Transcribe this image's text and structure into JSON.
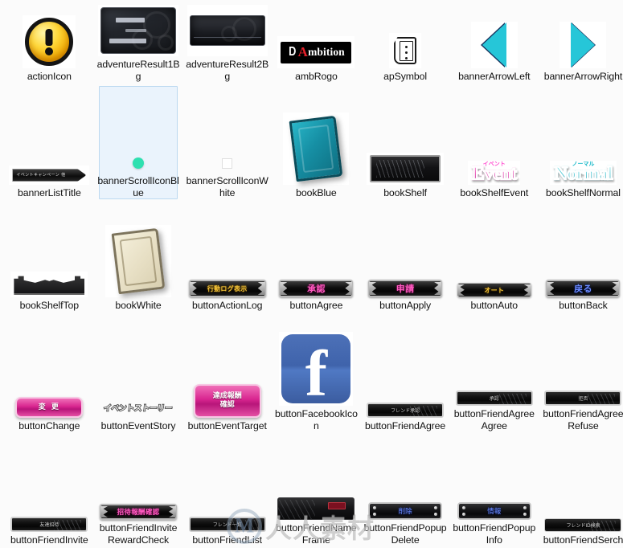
{
  "window": {
    "background_color": "#fbfbfb",
    "view": "icon-grid",
    "columns": 7,
    "rows": 5
  },
  "watermark": {
    "logo_letter": "M",
    "text": "人人素材"
  },
  "items": [
    {
      "id": "actionIcon",
      "label": "actionIcon",
      "icon": "warning-exclamation-icon",
      "selected": false
    },
    {
      "id": "adventureResult1Bg",
      "label": "adventureResult1Bg",
      "icon": "dark-card-background",
      "selected": false
    },
    {
      "id": "adventureResult2Bg",
      "label": "adventureResult2Bg",
      "icon": "dark-bar-background",
      "selected": false
    },
    {
      "id": "ambRogo",
      "label": "ambRogo",
      "icon": "ambition-logo",
      "selected": false,
      "logo": {
        "prefix": "D",
        "accent": "A",
        "rest": "mbition",
        "accent_color": "#e4202a"
      }
    },
    {
      "id": "apSymbol",
      "label": "apSymbol",
      "icon": "ap-scroll-symbol",
      "selected": false
    },
    {
      "id": "bannerArrowLeft",
      "label": "bannerArrowLeft",
      "icon": "triangle-left-icon",
      "selected": false,
      "color": "#26c6d8",
      "edge_color": "#17335e"
    },
    {
      "id": "bannerArrowRight",
      "label": "bannerArrowRight",
      "icon": "triangle-right-icon",
      "selected": false,
      "color": "#26c6d8",
      "edge_color": "#17335e"
    },
    {
      "id": "bannerListTitle",
      "label": "bannerListTitle",
      "icon": "dark-banner-ribbon",
      "selected": false,
      "jp_text": "イベントキャンペーン 他"
    },
    {
      "id": "bannerScrollIconBlue",
      "label": "bannerScrollIconBlue",
      "icon": "teal-dot-icon",
      "selected": true,
      "color": "#2ee0b0"
    },
    {
      "id": "bannerScrollIconWhite",
      "label": "bannerScrollIconWhite",
      "icon": "white-dot-icon",
      "selected": false,
      "color": "#ffffff"
    },
    {
      "id": "bookBlue",
      "label": "bookBlue",
      "icon": "blue-book-icon",
      "selected": false
    },
    {
      "id": "bookShelf",
      "label": "bookShelf",
      "icon": "dark-shelf-icon",
      "selected": false
    },
    {
      "id": "bookShelfEvent",
      "label": "bookShelfEvent",
      "icon": "event-wordart",
      "selected": false,
      "word": "Event",
      "kana": "イベント"
    },
    {
      "id": "bookShelfNormal",
      "label": "bookShelfNormal",
      "icon": "normal-wordart",
      "selected": false,
      "word": "Normal",
      "kana": "ノーマル"
    },
    {
      "id": "bookShelfTop",
      "label": "bookShelfTop",
      "icon": "shelf-top-ornament",
      "selected": false
    },
    {
      "id": "bookWhite",
      "label": "bookWhite",
      "icon": "white-book-icon",
      "selected": false
    },
    {
      "id": "buttonActionLog",
      "label": "buttonActionLog",
      "icon": "ornate-button",
      "selected": false,
      "jp_text": "行動ログ表示",
      "text_color": "gold"
    },
    {
      "id": "buttonAgree",
      "label": "buttonAgree",
      "icon": "ornate-button",
      "selected": false,
      "jp_text": "承認",
      "text_color": "pink"
    },
    {
      "id": "buttonApply",
      "label": "buttonApply",
      "icon": "ornate-button",
      "selected": false,
      "jp_text": "申請",
      "text_color": "pink"
    },
    {
      "id": "buttonAuto",
      "label": "buttonAuto",
      "icon": "ornate-button",
      "selected": false,
      "jp_text": "オート",
      "text_color": "gold"
    },
    {
      "id": "buttonBack",
      "label": "buttonBack",
      "icon": "ornate-button",
      "selected": false,
      "jp_text": "戻る",
      "text_color": "blue"
    },
    {
      "id": "buttonChange",
      "label": "buttonChange",
      "icon": "pink-button",
      "selected": false,
      "jp_text": "変 更"
    },
    {
      "id": "buttonEventStory",
      "label": "buttonEventStory",
      "icon": "event-story-text",
      "selected": false,
      "jp_text": "イベントストーリー"
    },
    {
      "id": "buttonEventTarget",
      "label": "buttonEventTarget",
      "icon": "pink-button",
      "selected": false,
      "jp_text": "達成報酬",
      "jp_text2": "確認"
    },
    {
      "id": "buttonFacebookIcon",
      "label": "buttonFacebookIcon",
      "icon": "facebook-icon",
      "selected": false,
      "glyph": "f",
      "color": "#3f63ab"
    },
    {
      "id": "buttonFriendAgree",
      "label": "buttonFriendAgree",
      "icon": "dark-bar-button",
      "selected": false,
      "jp_text": "フレンド承認"
    },
    {
      "id": "buttonFriendAgreeAgree",
      "label": "buttonFriendAgreeAgree",
      "icon": "dark-bar-button",
      "selected": false,
      "jp_text": "承認"
    },
    {
      "id": "buttonFriendAgreeRefuse",
      "label": "buttonFriendAgreeRefuse",
      "icon": "dark-bar-button",
      "selected": false,
      "jp_text": "拒否"
    },
    {
      "id": "buttonFriendInvite",
      "label": "buttonFriendInvite",
      "icon": "dark-bar-button",
      "selected": false,
      "jp_text": "友達招待"
    },
    {
      "id": "buttonFriendInviteRewardCheck",
      "label": "buttonFriendInviteRewardCheck",
      "icon": "ornate-button",
      "selected": false,
      "jp_text": "招待報酬確認",
      "text_color": "pink"
    },
    {
      "id": "buttonFriendList",
      "label": "buttonFriendList",
      "icon": "dark-bar-button",
      "selected": false,
      "jp_text": "フレンド一覧"
    },
    {
      "id": "buttonFriendNameFrame",
      "label": "buttonFriendNameFrame",
      "icon": "name-frame",
      "selected": false
    },
    {
      "id": "buttonFriendPopupDelete",
      "label": "buttonFriendPopupDelete",
      "icon": "rivet-button",
      "selected": false,
      "jp_text": "削除",
      "text_color": "blue"
    },
    {
      "id": "buttonFriendPopupInfo",
      "label": "buttonFriendPopupInfo",
      "icon": "rivet-button",
      "selected": false,
      "jp_text": "情報",
      "text_color": "blue"
    },
    {
      "id": "buttonFriendSerch",
      "label": "buttonFriendSerch",
      "icon": "dark-bar-button",
      "selected": false,
      "jp_text": "フレンドID検索"
    }
  ]
}
